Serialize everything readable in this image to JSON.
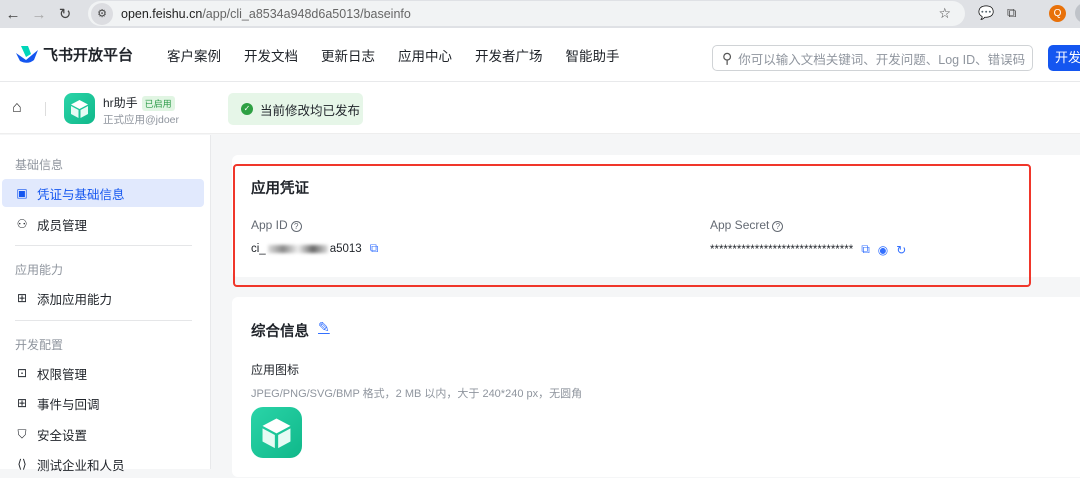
{
  "browser": {
    "url_host": "open.feishu.cn",
    "url_path": "/app/cli_a8534a948d6a5013/baseinfo",
    "profile_initial": "Q"
  },
  "header": {
    "brand": "飞书开放平台",
    "menu": [
      "客户案例",
      "开发文档",
      "更新日志",
      "应用中心",
      "开发者广场",
      "智能助手"
    ],
    "search_placeholder": "你可以输入文档关键词、开发问题、Log ID、错误码",
    "dev_button": "开发者"
  },
  "app": {
    "name": "hr助手",
    "status_badge": "已启用",
    "subtitle": "正式应用@jdoer",
    "publish_status": "当前修改均已发布"
  },
  "sidebar": {
    "sections": [
      {
        "title": "基础信息",
        "items": [
          {
            "label": "凭证与基础信息",
            "icon": "id-card-icon",
            "active": true
          },
          {
            "label": "成员管理",
            "icon": "user-add-icon"
          }
        ]
      },
      {
        "title": "应用能力",
        "items": [
          {
            "label": "添加应用能力",
            "icon": "grid-add-icon"
          }
        ]
      },
      {
        "title": "开发配置",
        "items": [
          {
            "label": "权限管理",
            "icon": "lock-box-icon"
          },
          {
            "label": "事件与回调",
            "icon": "event-icon"
          },
          {
            "label": "安全设置",
            "icon": "shield-icon"
          },
          {
            "label": "测试企业和人员",
            "icon": "code-icon"
          }
        ]
      }
    ]
  },
  "credentials": {
    "title": "应用凭证",
    "app_id_label": "App ID",
    "app_id_prefix": "ci_",
    "app_id_suffix": "a5013",
    "app_secret_label": "App Secret",
    "app_secret_value": "********************************"
  },
  "general": {
    "title": "综合信息",
    "icon_label": "应用图标",
    "icon_hint": "JPEG/PNG/SVG/BMP 格式，2 MB 以内，大于 240*240 px，无圆角"
  },
  "colors": {
    "accent": "#1456f0",
    "highlight": "#f0362a",
    "success": "#2ea043"
  }
}
